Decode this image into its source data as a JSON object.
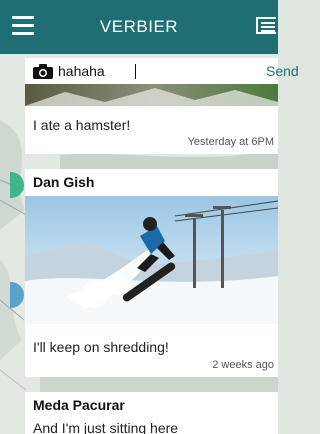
{
  "app": {
    "title": "VERBIER"
  },
  "icons": {
    "menu": "menu-icon",
    "list": "list-view-icon",
    "camera": "camera-icon"
  },
  "colors": {
    "header": "#1e6e73",
    "accent": "#1e6e73",
    "card": "#ffffff"
  },
  "compose": {
    "value": "hahaha",
    "send_label": "Send"
  },
  "posts": [
    {
      "text": "I ate a hamster!",
      "time": "Yesterday at 6PM"
    },
    {
      "author": "Dan Gish",
      "text": "I'll keep on shredding!",
      "time": "2 weeks ago"
    },
    {
      "author": "Meda Pacurar",
      "text": "And I'm just sitting here"
    }
  ]
}
